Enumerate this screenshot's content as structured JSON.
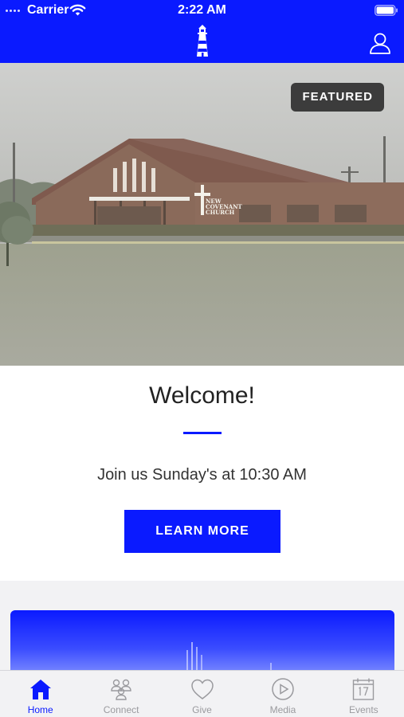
{
  "status_bar": {
    "carrier": "Carrier",
    "time": "2:22 AM"
  },
  "header": {
    "logo_icon": "lighthouse-icon",
    "profile_icon": "user-icon"
  },
  "hero": {
    "badge": "FEATURED",
    "image_alt": "church-building-photo",
    "sign_lines": [
      "NEW",
      "COVENANT",
      "CHURCH"
    ]
  },
  "welcome": {
    "title": "Welcome!",
    "subtitle": "Join us Sunday's at 10:30 AM",
    "button": "LEARN MORE"
  },
  "tabs": [
    {
      "label": "Home",
      "icon": "home-icon",
      "active": true
    },
    {
      "label": "Connect",
      "icon": "people-icon",
      "active": false
    },
    {
      "label": "Give",
      "icon": "heart-icon",
      "active": false
    },
    {
      "label": "Media",
      "icon": "play-icon",
      "active": false
    },
    {
      "label": "Events",
      "icon": "calendar-icon",
      "active": false
    }
  ],
  "colors": {
    "brand": "#0a1aff",
    "tab_inactive": "#9a9a9e",
    "badge_bg": "#282828"
  }
}
